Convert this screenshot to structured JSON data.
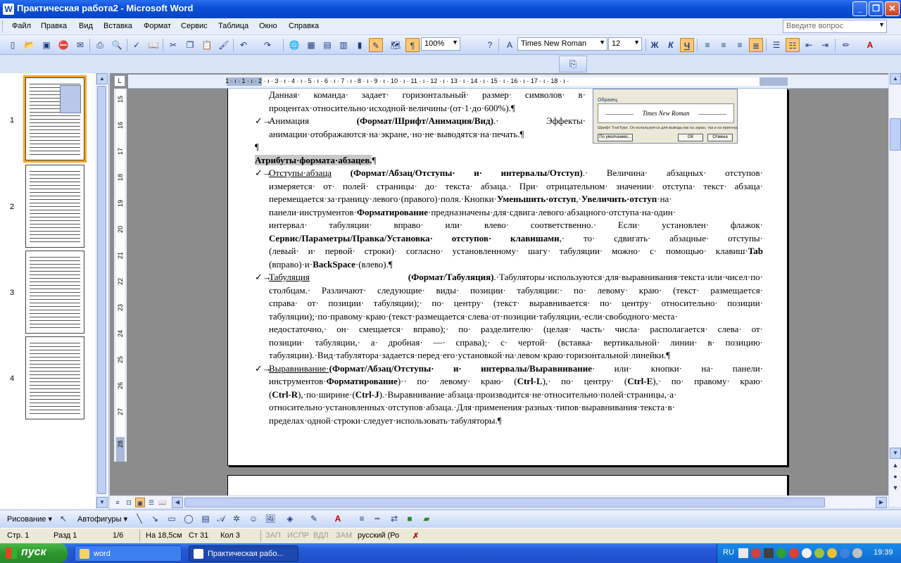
{
  "window": {
    "title": "Практическая  работа2 - Microsoft Word",
    "app_icon": "W",
    "minimize": "_",
    "maximize": "❐",
    "close": "✕"
  },
  "menu": {
    "items": [
      "Файл",
      "Правка",
      "Вид",
      "Вставка",
      "Формат",
      "Сервис",
      "Таблица",
      "Окно",
      "Справка"
    ],
    "help_placeholder": "Введите вопрос"
  },
  "toolbar": {
    "zoom": "100%",
    "font": "Times New Roman",
    "size": "12",
    "icons": [
      "new-icon",
      "open-icon",
      "save-icon",
      "permission-icon",
      "mail-icon",
      "print-icon",
      "print-preview-icon",
      "spelling-icon",
      "research-icon",
      "cut-icon",
      "copy-icon",
      "paste-icon",
      "format-painter-icon",
      "undo-icon",
      "redo-icon",
      "hyperlink-icon",
      "tables-borders-icon",
      "insert-table-icon",
      "excel-icon",
      "columns-icon",
      "drawing-icon",
      "document-map-icon",
      "show-hide-icon",
      "help-icon"
    ],
    "bold": "Ж",
    "italic": "К",
    "underline": "Ч",
    "show_hide": "¶"
  },
  "ruler": {
    "h_numbers": "1 · ı · 1 · ı · 2 · ı · 3 · ı · 4 · ı · 5 · ı · 6 · ı · 7 · ı · 8 · ı · 9 · ı · 10 · ı · 11 · ı · 12 · ı · 13 · ı · 14 · ı · 15 · ı · 16 · ı · 17 · ı · 18 · ı · ",
    "v_numbers": [
      "15",
      "16",
      "17",
      "18",
      "19",
      "20",
      "21",
      "22",
      "23",
      "24",
      "25",
      "26",
      "27",
      "28"
    ],
    "tab_marker": "L"
  },
  "thumbnails": [
    "1",
    "2",
    "3",
    "4"
  ],
  "figure": {
    "label": "Образец",
    "sample": "Times New Roman",
    "note": "Шрифт TrueType. Он используется для вывода как на экран, так и на принтер.",
    "btn_default": "По умолчанию...",
    "btn_ok": "ОК",
    "btn_cancel": "Отмена"
  },
  "document": {
    "line1": "Данная· команда· задает· горизонтальный· размер· символов· в·",
    "line2": "процентах·относительно·исходной·величины·(от·1·до·600%).¶",
    "anim_label": "Анимация",
    "anim_bold": "(Формат/Шрифт/Анимация/Вид)",
    "anim_rest": ".· Эффекты·",
    "anim_line2": "анимации·отображаются·на·экране,·но·не·выводятся·на·печать.¶",
    "empty_para": "¶",
    "heading": "Атрибуты·формата·абзацев.",
    "heading_mark": "¶",
    "indent": {
      "u": "Отступы·абзаца",
      "b1": "(Формат/Абзац/Отступы· и· интервалы/Отступ)",
      "t1": ".· Величина· абзацных· отступов·",
      "l2": "измеряется· от· полей· страницы· до· текста· абзаца.· При· отрицательном· значении· отступа· текст· абзаца·",
      "l3": "перемещается·за·границу·левого·(правого)·поля.·Кнопки·",
      "b2": "Уменьшить·отступ",
      "t2": ",·",
      "b3": "Увеличить·отступ",
      "t3": "·на·",
      "l4a": "панели·инструментов·",
      "b4": "Форматирование",
      "l4b": "·предназначены·для·сдвига·левого·абзацного·отступа·на·один·",
      "l5": "интервал· табуляции· вправо· или· влево· соответственно.· Если· установлен· флажок·",
      "b5": "Сервис/Параметры/Правка/Установка· отступов· клавишами",
      "l6b": ",· то· сдвигать· абзацные· отступы·",
      "l7a": "(левый· и· первой· строки)· согласно· установленному· шагу· табуляции· можно· с· помощью· клавиш·",
      "b6": "Tab",
      "l8a": "(вправо)·и·",
      "b7": "BackSpace",
      "l8b": "·(влево).¶"
    },
    "tab": {
      "u": "Табуляция",
      "b1": "(Формат/Табуляция)",
      "t1": ".·Табуляторы·используются·для·выравнивания·текста·или·чисел·по·",
      "l2": "столбцам.· Различают· следующие· виды· позиции· табуляции:· по· левому· краю· (текст· размещается·",
      "l3": "справа· от· позиции· табуляции);· по· центру· (текст· выравнивается· по· центру· относительно· позиции·",
      "l4": "табуляции);·по·правому·краю·(текст·размещается·слева·от·позиции·табуляции,·если·свободного·места·",
      "l5": "недостаточно,· он· смещается· вправо);· по· разделителю· (целая· часть· числа· располагается· слева· от·",
      "l6": "позиции· табуляции,· а· дробная· —· справа);· с· чертой· (вставка· вертикальной· линии· в· позицию·",
      "l7": "табуляции).·Вид·табулятора·задается·перед·его·установкой·на·левом·краю·горизонтальной·линейки.¶"
    },
    "align": {
      "u": "Выравнивание·",
      "b1": "(Формат/Абзац/Отступы· и· интервалы/Выравнивание",
      "t1": "· или· кнопки· на· панели·",
      "l2a": "инструментов·",
      "b2": "Форматирование",
      "l2b": ")·· по· левому· краю· (",
      "b3": "Ctrl-L",
      "l2c": "),· по· центру· (",
      "b4": "Ctrl-E",
      "l2d": "),· по· правому· краю·",
      "l3a": "(",
      "b5": "Ctrl-R",
      "l3b": "),·по·ширине·(",
      "b6": "Ctrl-J",
      "l3c": ").·Выравнивание·абзаца·производится·не·относительно·полей·страницы,·а·",
      "l4": "относительно·установленных·отступов·абзаца.·Для·применения·разных·типов·выравнивания·текста·в·",
      "l5": "пределах·одной·строки·следует·использовать·табуляторы.¶"
    },
    "bullet": "✓→"
  },
  "drawing": {
    "draw": "Рисование ▾",
    "autoshapes": "Автофигуры ▾"
  },
  "status": {
    "page": "Стр. 1",
    "section": "Разд 1",
    "pages": "1/6",
    "at": "На 18,5см",
    "line": "Ст 31",
    "col": "Кол 3",
    "rec": "ЗАП",
    "trk": "ИСПР",
    "ext": "ВДЛ",
    "ovr": "ЗАМ",
    "lang": "русский (Ро"
  },
  "taskbar": {
    "start": "пуск",
    "task1": "word",
    "task2": "Практическая  рабо...",
    "lang": "RU",
    "clock": "19:39"
  }
}
